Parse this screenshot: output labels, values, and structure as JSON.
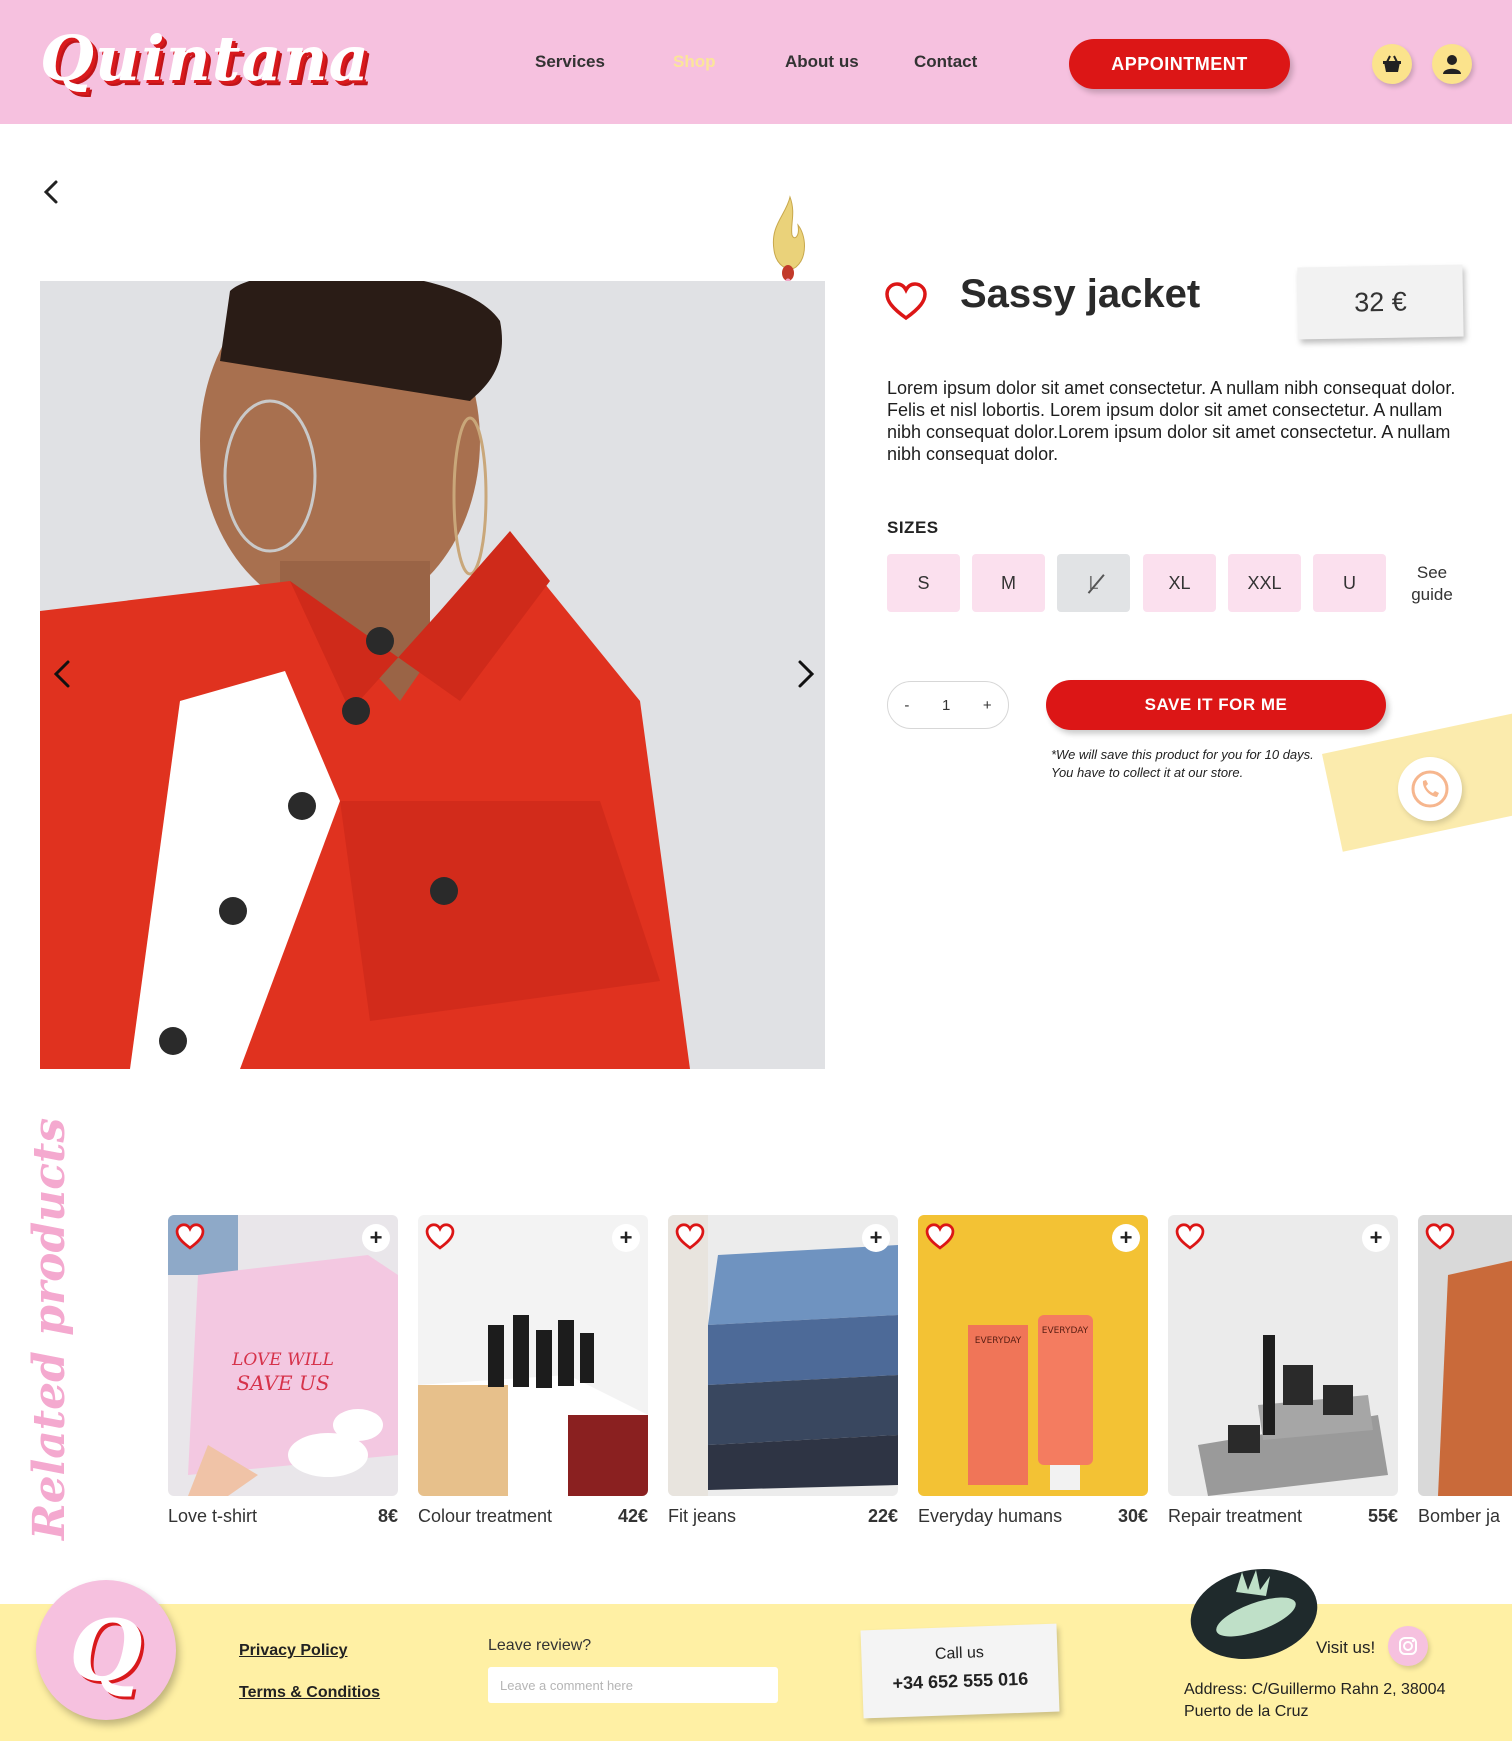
{
  "header": {
    "logo": "Quintana",
    "nav": [
      "Services",
      "Shop",
      "About us",
      "Contact"
    ],
    "active_nav": "Shop",
    "appointment_label": "APPOINTMENT",
    "icons": [
      "basket-icon",
      "user-icon"
    ]
  },
  "product": {
    "title": "Sassy jacket",
    "price": "32 €",
    "description": "Lorem ipsum dolor sit amet consectetur. A nullam nibh consequat dolor. Felis et nisl lobortis. Lorem ipsum dolor sit amet consectetur. A nullam nibh consequat dolor.Lorem ipsum dolor sit amet consectetur. A nullam nibh consequat dolor.",
    "sizes_label": "SIZES",
    "sizes": [
      "S",
      "M",
      "L",
      "XL",
      "XXL",
      "U"
    ],
    "unavailable_size": "L",
    "see_guide": "See guide",
    "qty_minus": "-",
    "quantity": "1",
    "qty_plus": "+",
    "save_label": "SAVE IT FOR ME",
    "save_note": "*We will save this product for you for 10 days. You have to collect it at our store."
  },
  "related": {
    "title": "Related products",
    "items": [
      {
        "name": "Love t-shirt",
        "price": "8€",
        "image_text": "Love will save us"
      },
      {
        "name": "Colour treatment",
        "price": "42€"
      },
      {
        "name": "Fit jeans",
        "price": "22€"
      },
      {
        "name": "Everyday humans",
        "price": "30€"
      },
      {
        "name": "Repair treatment",
        "price": "55€"
      },
      {
        "name": "Bomber ja",
        "price": ""
      }
    ]
  },
  "footer": {
    "privacy": "Privacy Policy",
    "terms": "Terms & Conditios",
    "review_label": "Leave review?",
    "review_placeholder": "Leave a comment here",
    "call_label": "Call us",
    "phone": "+34 652 555 016",
    "visit_label": "Visit us!",
    "address": "Address: C/Guillermo Rahn 2, 38004 Puerto de la Cruz"
  },
  "colors": {
    "header_bg": "#f6c1df",
    "accent_red": "#dc1616",
    "footer_bg": "#fff0a4",
    "active_nav": "#fbe59a",
    "size_bg": "#fbe0ee"
  }
}
